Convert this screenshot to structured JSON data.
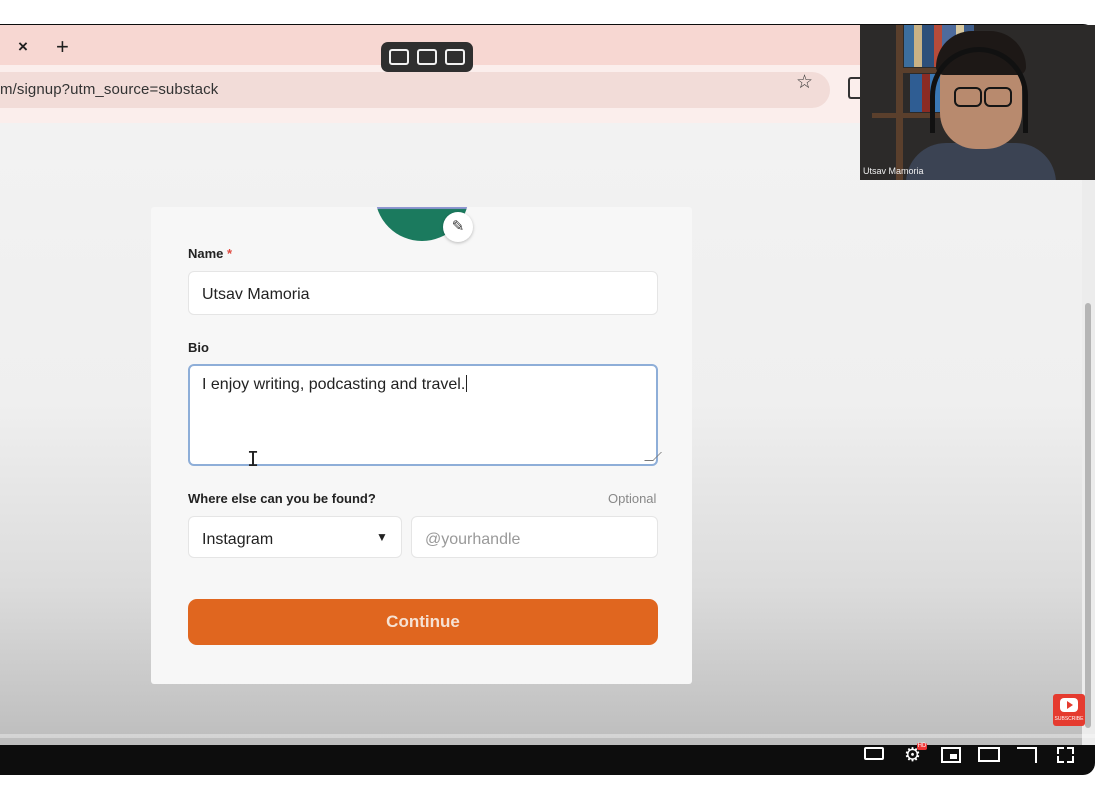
{
  "browser": {
    "tab_close": "×",
    "tab_new": "+",
    "url": "m/signup?utm_source=substack"
  },
  "form": {
    "name_label": "Name",
    "required_mark": "*",
    "name_value": "Utsav Mamoria",
    "bio_label": "Bio",
    "bio_value": "I enjoy writing, podcasting and travel.",
    "found_label": "Where else can you be found?",
    "optional_label": "Optional",
    "platform_selected": "Instagram",
    "handle_placeholder": "@yourhandle",
    "continue_label": "Continue"
  },
  "camera": {
    "name": "Utsav Mamoria"
  },
  "player": {
    "subscribe_label": "SUBSCRIBE",
    "hd_badge": "HD"
  },
  "colors": {
    "tab_bar": "#f7d7d2",
    "accent": "#e0661f",
    "focus_border": "#8eaed8"
  }
}
